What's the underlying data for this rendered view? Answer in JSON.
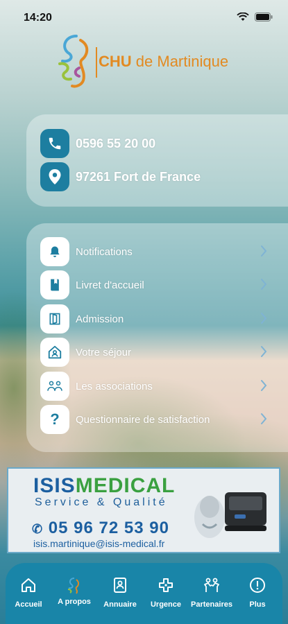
{
  "status_bar": {
    "time": "14:20"
  },
  "logo": {
    "text_bold": "CHU",
    "text_rest": " de Martinique"
  },
  "contact": {
    "phone": "0596 55 20 00",
    "address": "97261 Fort de France"
  },
  "menu": {
    "items": [
      {
        "label": "Notifications",
        "icon": "bell-icon"
      },
      {
        "label": "Livret d'accueil",
        "icon": "book-icon"
      },
      {
        "label": "Admission",
        "icon": "door-icon"
      },
      {
        "label": "Votre séjour",
        "icon": "house-person-icon"
      },
      {
        "label": "Les associations",
        "icon": "people-icon"
      },
      {
        "label": "Questionnaire de satisfaction",
        "icon": "question-icon"
      }
    ]
  },
  "ad": {
    "brand_a": "ISIS",
    "brand_b": "MEDICAL",
    "tagline": "Service & Qualité",
    "phone": "05 96 72 53 90",
    "email": "isis.martinique@isis-medical.fr"
  },
  "tabbar": {
    "items": [
      {
        "label": "Accueil",
        "icon": "home-icon"
      },
      {
        "label": "A propos",
        "icon": "chu-logo-icon"
      },
      {
        "label": "Annuaire",
        "icon": "contacts-book-icon"
      },
      {
        "label": "Urgence",
        "icon": "medical-cross-icon"
      },
      {
        "label": "Partenaires",
        "icon": "partners-icon"
      },
      {
        "label": "Plus",
        "icon": "more-icon"
      }
    ]
  },
  "colors": {
    "accent": "#1985a8",
    "logo_orange": "#e28a22"
  }
}
